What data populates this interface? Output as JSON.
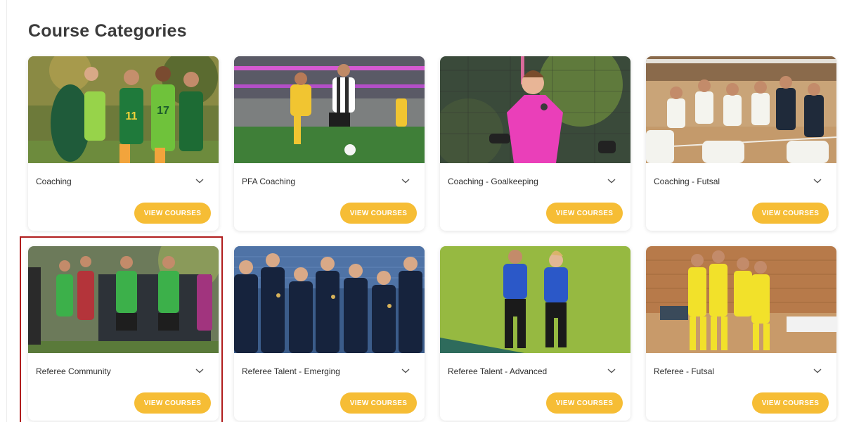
{
  "page": {
    "title": "Course Categories"
  },
  "theme": {
    "button_color": "#f6bd35",
    "highlight_color": "#b01c1c",
    "title_color": "#3b3b3b"
  },
  "categories": [
    {
      "title": "Coaching",
      "button_label": "VIEW COURSES",
      "icon": "chevron-down-icon",
      "photo": "youth players in green and gold with coach"
    },
    {
      "title": "PFA Coaching",
      "button_label": "VIEW COURSES",
      "icon": "chevron-down-icon",
      "photo": "stadium match players in gold and white"
    },
    {
      "title": "Coaching - Goalkeeping",
      "button_label": "VIEW COURSES",
      "icon": "chevron-down-icon",
      "photo": "goalkeeper in pink jersey"
    },
    {
      "title": "Coaching - Futsal",
      "button_label": "VIEW COURSES",
      "icon": "chevron-down-icon",
      "photo": "futsal team huddle on indoor court"
    },
    {
      "title": "Referee Community",
      "button_label": "VIEW COURSES",
      "icon": "chevron-down-icon",
      "photo": "referees in green shirts with players"
    },
    {
      "title": "Referee Talent - Emerging",
      "button_label": "VIEW COURSES",
      "icon": "chevron-down-icon",
      "photo": "group of referees in navy in stadium"
    },
    {
      "title": "Referee Talent - Advanced",
      "button_label": "VIEW COURSES",
      "icon": "chevron-down-icon",
      "photo": "two referees in blue on grass"
    },
    {
      "title": "Referee - Futsal",
      "button_label": "VIEW COURSES",
      "icon": "chevron-down-icon",
      "photo": "futsal referees in yellow indoors"
    }
  ]
}
